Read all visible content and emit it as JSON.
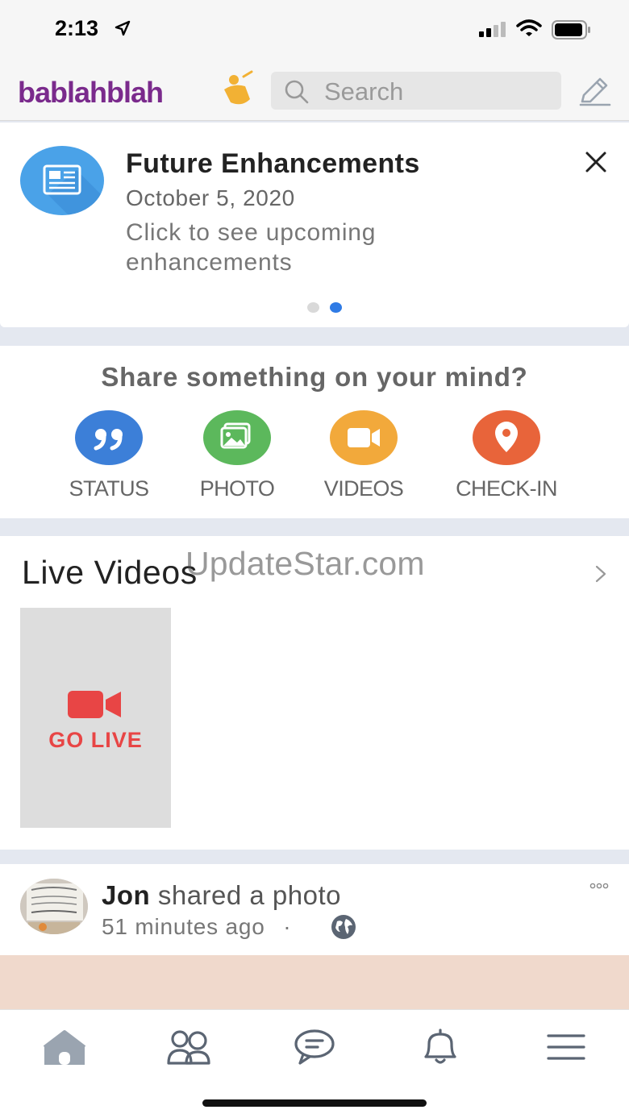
{
  "status_bar": {
    "time": "2:13"
  },
  "header": {
    "logo_text": "bablahblah",
    "search_placeholder": "Search"
  },
  "announcement": {
    "title": "Future Enhancements",
    "date": "October 5, 2020",
    "description": "Click to see upcoming enhancements",
    "page_count": 2,
    "active_page": 2
  },
  "share": {
    "title": "Share something on your mind?",
    "buttons": [
      {
        "label": "STATUS",
        "icon": "quote-icon",
        "color": "#3c7fd8"
      },
      {
        "label": "PHOTO",
        "icon": "photo-icon",
        "color": "#5cb85c"
      },
      {
        "label": "VIDEOS",
        "icon": "video-camera-icon",
        "color": "#f2a93b"
      },
      {
        "label": "CHECK-IN",
        "icon": "location-pin-icon",
        "color": "#e8643a"
      }
    ]
  },
  "live_videos": {
    "title": "Live Videos",
    "go_live_label": "GO LIVE"
  },
  "watermark": "UpdateStar.com",
  "post": {
    "author": "Jon",
    "action": " shared a photo",
    "time": "51 minutes ago",
    "separator": "·"
  },
  "tabbar": {
    "items": [
      "home-icon",
      "friends-icon",
      "chat-icon",
      "bell-icon",
      "menu-icon"
    ]
  },
  "colors": {
    "accent_blue": "#2f7be5",
    "go_live_red": "#e84545"
  }
}
